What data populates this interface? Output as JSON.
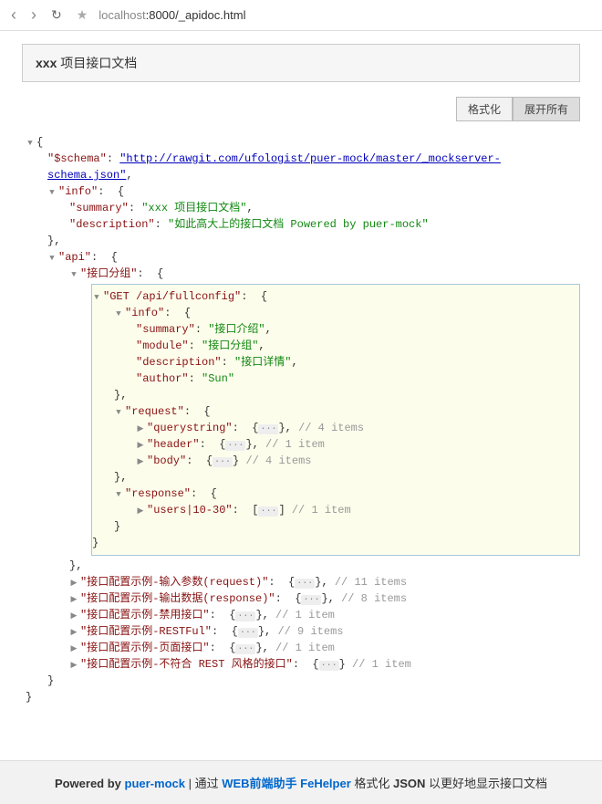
{
  "browser": {
    "url_host": "localhost",
    "url_path": ":8000/_apidoc.html"
  },
  "title": {
    "bold": "xxx",
    "rest": " 项目接口文档"
  },
  "buttons": {
    "format": "格式化",
    "expand": "展开所有"
  },
  "json": {
    "schema_key": "\"$schema\"",
    "schema_val": "\"http://rawgit.com/ufologist/puer-mock/master/_mockserver-schema.json\"",
    "info_key": "\"info\"",
    "summary_key": "\"summary\"",
    "summary_val": "\"xxx 项目接口文档\"",
    "description_key": "\"description\"",
    "description_val": "\"如此高大上的接口文档 Powered by puer-mock\"",
    "api_key": "\"api\"",
    "group_key": "\"接口分组\"",
    "endpoint_key": "\"GET /api/fullconfig\"",
    "info2_key": "\"info\"",
    "summary2_key": "\"summary\"",
    "summary2_val": "\"接口介绍\"",
    "module_key": "\"module\"",
    "module_val": "\"接口分组\"",
    "description2_key": "\"description\"",
    "description2_val": "\"接口详情\"",
    "author_key": "\"author\"",
    "author_val": "\"Sun\"",
    "request_key": "\"request\"",
    "querystring_key": "\"querystring\"",
    "qs_comment": "// 4 items",
    "header_key": "\"header\"",
    "header_comment": "// 1 item",
    "body_key": "\"body\"",
    "body_comment": "// 4 items",
    "response_key": "\"response\"",
    "users_key": "\"users|10-30\"",
    "users_comment": "// 1 item",
    "ex1_key": "\"接口配置示例-输入参数(request)\"",
    "ex1_comment": "// 11 items",
    "ex2_key": "\"接口配置示例-输出数据(response)\"",
    "ex2_comment": "// 8 items",
    "ex3_key": "\"接口配置示例-禁用接口\"",
    "ex3_comment": "// 1 item",
    "ex4_key": "\"接口配置示例-RESTFul\"",
    "ex4_comment": "// 9 items",
    "ex5_key": "\"接口配置示例-页面接口\"",
    "ex5_comment": "// 1 item",
    "ex6_key": "\"接口配置示例-不符合 REST 风格的接口\"",
    "ex6_comment": "// 1 item"
  },
  "footer": {
    "p1": "Powered by ",
    "puer": "puer-mock",
    "p2": " | 通过 ",
    "web": "WEB前端助手 FeHelper",
    "p3": " 格式化 ",
    "json": "JSON",
    "p4": " 以更好地显示接口文档"
  }
}
